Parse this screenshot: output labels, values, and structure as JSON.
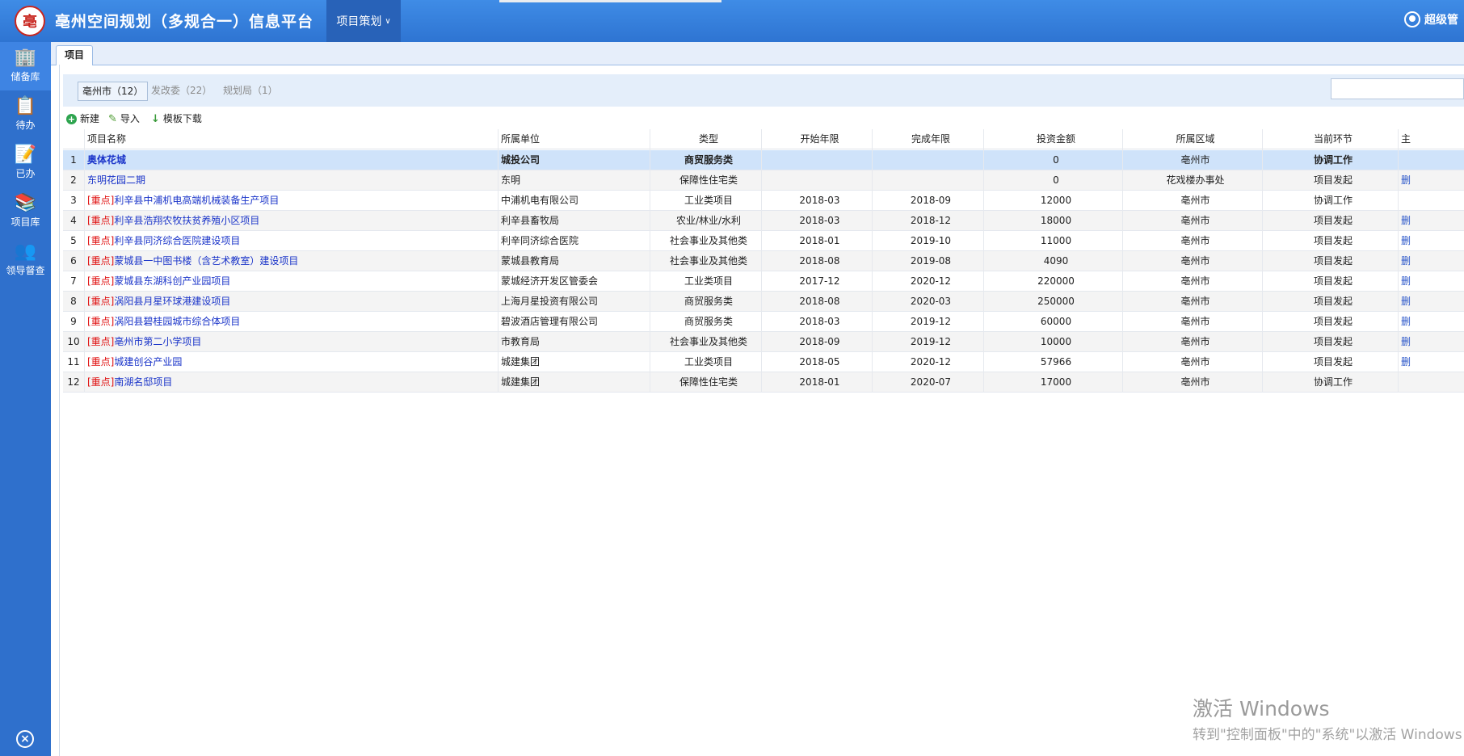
{
  "header": {
    "logo_glyph": "亳",
    "title": "亳州空间规划（多规合一）信息平台",
    "menu_label": "项目策划",
    "user_label": "超级管"
  },
  "sidebar": {
    "items": [
      {
        "label": "储备库",
        "icon": "building-icon"
      },
      {
        "label": "待办",
        "icon": "document-clock-icon"
      },
      {
        "label": "已办",
        "icon": "document-check-icon"
      },
      {
        "label": "项目库",
        "icon": "books-icon"
      },
      {
        "label": "领导督查",
        "icon": "supervisor-icon"
      }
    ],
    "close_icon": "close-icon"
  },
  "tabs": [
    {
      "label": "项目"
    }
  ],
  "filter": {
    "tabs": [
      {
        "label": "亳州市（12）"
      },
      {
        "label": "发改委（22）"
      },
      {
        "label": "规划局（1）"
      }
    ]
  },
  "toolbar": {
    "new_label": "新建",
    "import_label": "导入",
    "template_label": "模板下载"
  },
  "table": {
    "columns": [
      "项目名称",
      "所属单位",
      "类型",
      "开始年限",
      "完成年限",
      "投资金额",
      "所属区域",
      "当前环节",
      "主"
    ],
    "rows": [
      {
        "no": "1",
        "tag": "",
        "name": "奥体花城",
        "unit": "城投公司",
        "type": "商贸服务类",
        "start": "",
        "end": "",
        "amount": "0",
        "region": "亳州市",
        "stage": "协调工作",
        "edge": ""
      },
      {
        "no": "2",
        "tag": "",
        "name": "东明花园二期",
        "unit": "东明",
        "type": "保障性住宅类",
        "start": "",
        "end": "",
        "amount": "0",
        "region": "花戏楼办事处",
        "stage": "项目发起",
        "edge": "删"
      },
      {
        "no": "3",
        "tag": "[重点]",
        "name": "利辛县中浦机电高端机械装备生产项目",
        "unit": "中浦机电有限公司",
        "type": "工业类项目",
        "start": "2018-03",
        "end": "2018-09",
        "amount": "12000",
        "region": "亳州市",
        "stage": "协调工作",
        "edge": ""
      },
      {
        "no": "4",
        "tag": "[重点]",
        "name": "利辛县浩翔农牧扶贫养殖小区项目",
        "unit": "利辛县畜牧局",
        "type": "农业/林业/水利",
        "start": "2018-03",
        "end": "2018-12",
        "amount": "18000",
        "region": "亳州市",
        "stage": "项目发起",
        "edge": "删"
      },
      {
        "no": "5",
        "tag": "[重点]",
        "name": "利辛县同济综合医院建设项目",
        "unit": "利辛同济综合医院",
        "type": "社会事业及其他类",
        "start": "2018-01",
        "end": "2019-10",
        "amount": "11000",
        "region": "亳州市",
        "stage": "项目发起",
        "edge": "删"
      },
      {
        "no": "6",
        "tag": "[重点]",
        "name": "蒙城县一中图书楼（含艺术教室）建设项目",
        "unit": "蒙城县教育局",
        "type": "社会事业及其他类",
        "start": "2018-08",
        "end": "2019-08",
        "amount": "4090",
        "region": "亳州市",
        "stage": "项目发起",
        "edge": "删"
      },
      {
        "no": "7",
        "tag": "[重点]",
        "name": "蒙城县东湖科创产业园项目",
        "unit": "蒙城经济开发区管委会",
        "type": "工业类项目",
        "start": "2017-12",
        "end": "2020-12",
        "amount": "220000",
        "region": "亳州市",
        "stage": "项目发起",
        "edge": "删"
      },
      {
        "no": "8",
        "tag": "[重点]",
        "name": "涡阳县月星环球港建设项目",
        "unit": "上海月星投资有限公司",
        "type": "商贸服务类",
        "start": "2018-08",
        "end": "2020-03",
        "amount": "250000",
        "region": "亳州市",
        "stage": "项目发起",
        "edge": "删"
      },
      {
        "no": "9",
        "tag": "[重点]",
        "name": "涡阳县碧桂园城市综合体项目",
        "unit": "碧波酒店管理有限公司",
        "type": "商贸服务类",
        "start": "2018-03",
        "end": "2019-12",
        "amount": "60000",
        "region": "亳州市",
        "stage": "项目发起",
        "edge": "删"
      },
      {
        "no": "10",
        "tag": "[重点]",
        "name": "亳州市第二小学项目",
        "unit": "市教育局",
        "type": "社会事业及其他类",
        "start": "2018-09",
        "end": "2019-12",
        "amount": "10000",
        "region": "亳州市",
        "stage": "项目发起",
        "edge": "删"
      },
      {
        "no": "11",
        "tag": "[重点]",
        "name": "城建创谷产业园",
        "unit": "城建集团",
        "type": "工业类项目",
        "start": "2018-05",
        "end": "2020-12",
        "amount": "57966",
        "region": "亳州市",
        "stage": "项目发起",
        "edge": "删"
      },
      {
        "no": "12",
        "tag": "[重点]",
        "name": "南湖名邸项目",
        "unit": "城建集团",
        "type": "保障性住宅类",
        "start": "2018-01",
        "end": "2020-07",
        "amount": "17000",
        "region": "亳州市",
        "stage": "协调工作",
        "edge": ""
      }
    ]
  },
  "watermark": {
    "line1": "激活 Windows",
    "line2": "转到\"控制面板\"中的\"系统\"以激活 Windows"
  },
  "colors": {
    "header_blue": "#3f8ce6",
    "sidebar_blue": "#2f70cc",
    "link_blue": "#1a34c9",
    "tag_red": "#e01010",
    "selected_row": "#cfe3fa"
  }
}
